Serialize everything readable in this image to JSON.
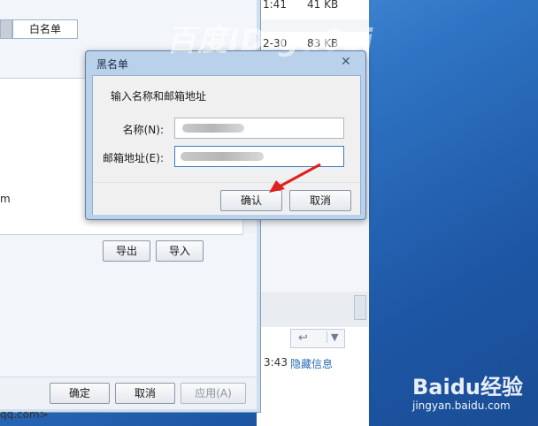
{
  "watermark": {
    "top": "百度ID gu0zi",
    "brand": "Baidu经验",
    "url": "jingyan.baidu.com"
  },
  "mail_list": {
    "rows": [
      {
        "time": "1:41",
        "size": "41 KB"
      },
      {
        "time": "2-30",
        "size": "83 KB"
      }
    ],
    "msg_time": "3:43",
    "hide_link": "隐藏信息"
  },
  "options_dialog": {
    "tab_label": "白名单",
    "partial_text": "m",
    "export_label": "导出",
    "import_label": "导入",
    "ok_label": "确定",
    "cancel_label": "取消",
    "apply_label": "应用(A)",
    "address_fragment": "qq.com>"
  },
  "blacklist_dialog": {
    "title": "黑名单",
    "close_glyph": "✕",
    "prompt": "输入名称和邮箱地址",
    "name_label": "名称(N):",
    "email_label": "邮箱地址(E):",
    "confirm_label": "确认",
    "cancel_label": "取消"
  },
  "colors": {
    "accent": "#2f74c4",
    "arrow": "#e02020"
  }
}
